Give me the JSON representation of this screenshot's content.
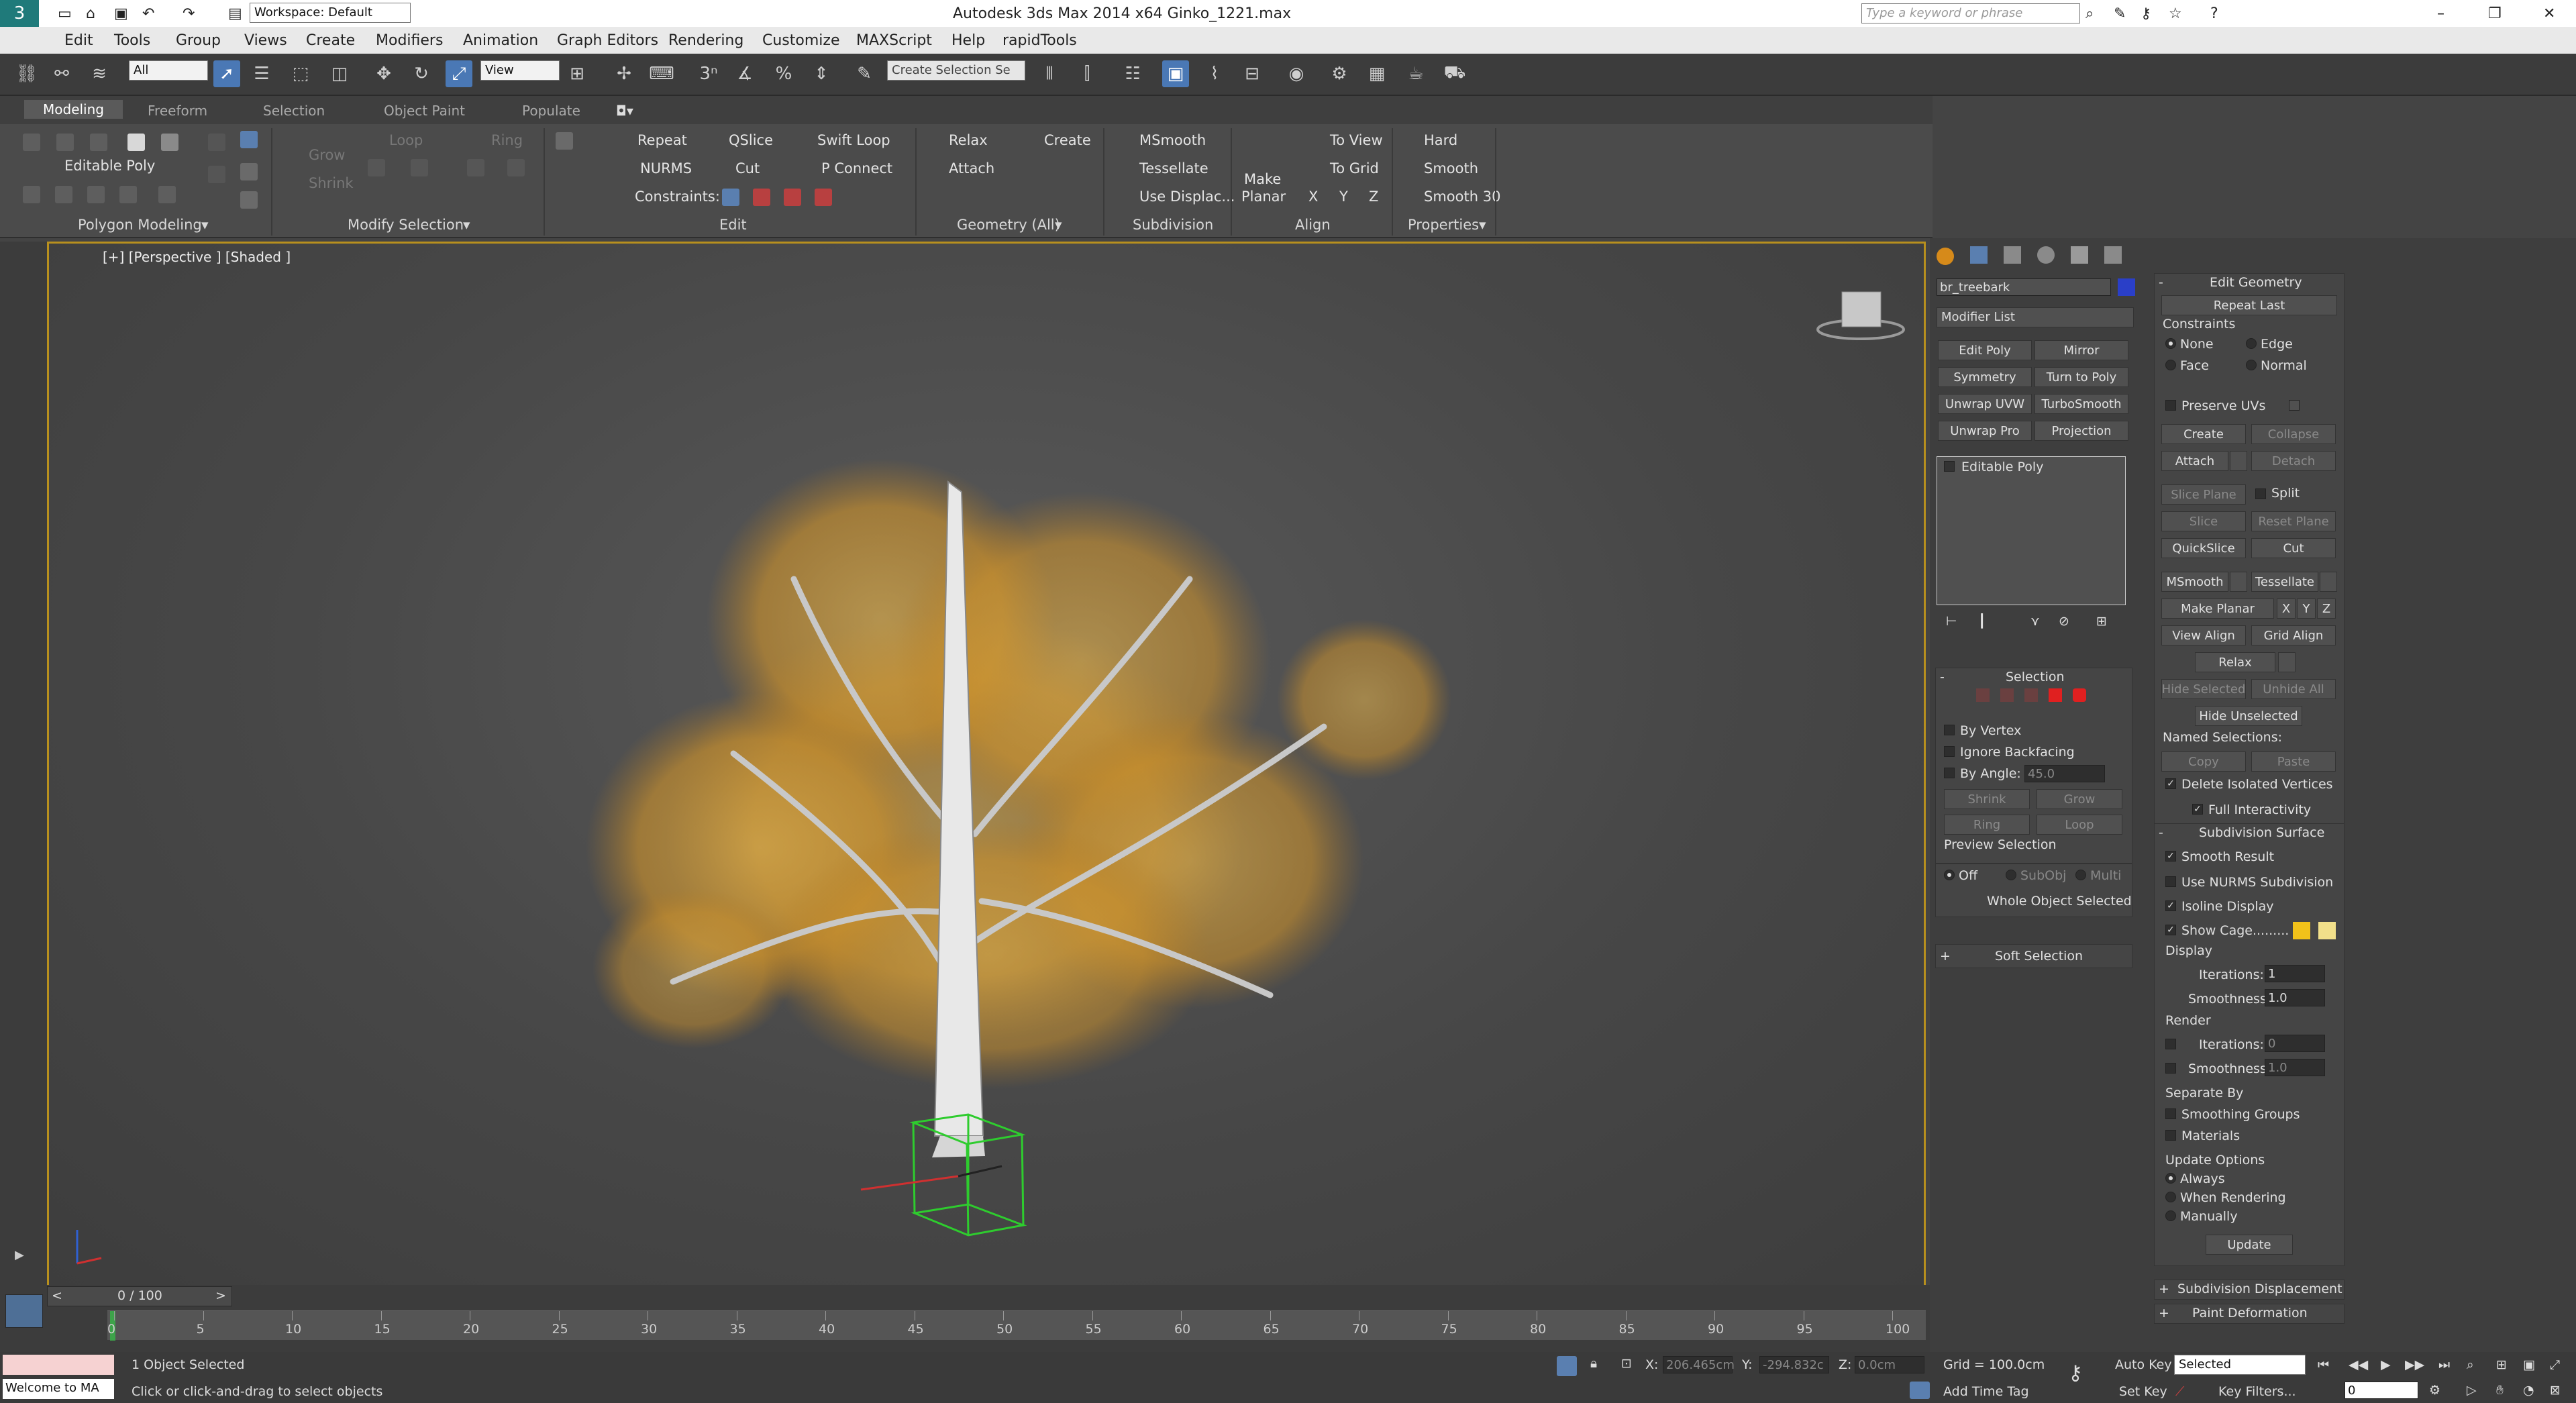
{
  "titlebar": {
    "workspace": "Workspace: Default",
    "title": "Autodesk 3ds Max  2014 x64     Ginko_1221.max",
    "search_placeholder": "Type a keyword or phrase"
  },
  "menu": [
    "Edit",
    "Tools",
    "Group",
    "Views",
    "Create",
    "Modifiers",
    "Animation",
    "Graph Editors",
    "Rendering",
    "Customize",
    "MAXScript",
    "Help",
    "rapidTools"
  ],
  "toolbar": {
    "filter_value": "All",
    "refcoord_value": "View",
    "selection_set_placeholder": "Create Selection Se"
  },
  "ribbon": {
    "tabs": [
      "Modeling",
      "Freeform",
      "Selection",
      "Object Paint",
      "Populate"
    ],
    "polygon_modeling": {
      "current": "Editable Poly",
      "label": "Polygon Modeling"
    },
    "modify_selection": {
      "grow": "Grow",
      "shrink": "Shrink",
      "loop": "Loop",
      "ring": "Ring",
      "label": "Modify Selection"
    },
    "edit": {
      "repeat": "Repeat",
      "qslice": "QSlice",
      "swift_loop": "Swift Loop",
      "nurms": "NURMS",
      "cut": "Cut",
      "p_connect": "P Connect",
      "constraints": "Constraints:",
      "label": "Edit"
    },
    "geometry": {
      "relax": "Relax",
      "create": "Create",
      "attach": "Attach",
      "label": "Geometry (All)"
    },
    "subdivision": {
      "msmooth": "MSmooth",
      "tessellate": "Tessellate",
      "use_displac": "Use Displac...",
      "label": "Subdivision"
    },
    "align": {
      "make": "Make",
      "planar": "Planar",
      "to_view": "To View",
      "to_grid": "To Grid",
      "x": "X",
      "y": "Y",
      "z": "Z",
      "label": "Align"
    },
    "properties": {
      "hard": "Hard",
      "smooth": "Smooth",
      "smooth30": "Smooth 30",
      "label": "Properties"
    }
  },
  "viewport": {
    "label": "[+] [Perspective ] [Shaded ]"
  },
  "command_panel": {
    "object_name": "br_treebark",
    "modifier_list": "Modifier List",
    "mod_buttons": [
      "Edit Poly",
      "Mirror",
      "Symmetry",
      "Turn to Poly",
      "Unwrap UVW",
      "TurboSmooth",
      "Unwrap Pro",
      "Projection"
    ],
    "stack_item": "Editable Poly",
    "selection": {
      "title": "Selection",
      "by_vertex": "By Vertex",
      "ignore_backfacing": "Ignore Backfacing",
      "by_angle": "By Angle:",
      "angle_value": "45.0",
      "shrink": "Shrink",
      "grow": "Grow",
      "ring": "Ring",
      "loop": "Loop",
      "preview_selection": "Preview Selection",
      "off": "Off",
      "subobj": "SubObj",
      "multi": "Multi",
      "whole_object": "Whole Object Selected"
    },
    "soft_selection": "Soft Selection",
    "edit_geometry": {
      "title": "Edit Geometry",
      "repeat_last": "Repeat Last",
      "constraints": "Constraints",
      "none": "None",
      "edge": "Edge",
      "face": "Face",
      "normal": "Normal",
      "preserve_uvs": "Preserve UVs",
      "create": "Create",
      "collapse": "Collapse",
      "attach": "Attach",
      "detach": "Detach",
      "slice_plane": "Slice Plane",
      "split": "Split",
      "slice": "Slice",
      "reset_plane": "Reset Plane",
      "quickslice": "QuickSlice",
      "cut": "Cut",
      "msmooth": "MSmooth",
      "tessellate": "Tessellate",
      "make_planar": "Make Planar",
      "x": "X",
      "y": "Y",
      "z": "Z",
      "view_align": "View Align",
      "grid_align": "Grid Align",
      "relax": "Relax",
      "hide_selected": "Hide Selected",
      "unhide_all": "Unhide All",
      "hide_unselected": "Hide Unselected",
      "named_selections": "Named Selections:",
      "copy": "Copy",
      "paste": "Paste",
      "delete_isolated": "Delete Isolated Vertices",
      "full_interactivity": "Full Interactivity"
    },
    "subdivision_surface": {
      "title": "Subdivision Surface",
      "smooth_result": "Smooth Result",
      "use_nurms": "Use NURMS Subdivision",
      "isoline": "Isoline Display",
      "show_cage": "Show Cage.........",
      "display": "Display",
      "iterations": "Iterations:",
      "iterations_value": "1",
      "smoothness": "Smoothness:",
      "smoothness_value": "1.0",
      "render": "Render",
      "render_iterations_value": "0",
      "render_smoothness_value": "1.0",
      "separate_by": "Separate By",
      "smoothing_groups": "Smoothing Groups",
      "materials": "Materials",
      "update_options": "Update Options",
      "always": "Always",
      "when_rendering": "When Rendering",
      "manually": "Manually",
      "update": "Update"
    },
    "subdivision_displacement": "Subdivision Displacement",
    "paint_deformation": "Paint Deformation",
    "colors": {
      "swatch_blue": "#2a3fc8",
      "cage_1": "#f2c21a",
      "cage_2": "#f2e08a"
    }
  },
  "timeline": {
    "frame": "0 / 100",
    "ticks": [
      "0",
      "5",
      "10",
      "15",
      "20",
      "25",
      "30",
      "35",
      "40",
      "45",
      "50",
      "55",
      "60",
      "65",
      "70",
      "75",
      "80",
      "85",
      "90",
      "95",
      "100"
    ]
  },
  "status": {
    "maxscript": "Welcome to MA",
    "selected": "1 Object Selected",
    "prompt": "Click or click-and-drag to select objects",
    "x_label": "X:",
    "x_value": "206.465cm",
    "y_label": "Y:",
    "y_value": "-294.832c",
    "z_label": "Z:",
    "z_value": "0.0cm",
    "grid": "Grid = 100.0cm",
    "add_time_tag": "Add Time Tag",
    "auto_key": "Auto Key",
    "set_key": "Set Key",
    "selected_dd": "Selected",
    "key_filters": "Key Filters...",
    "frame_value": "0"
  }
}
